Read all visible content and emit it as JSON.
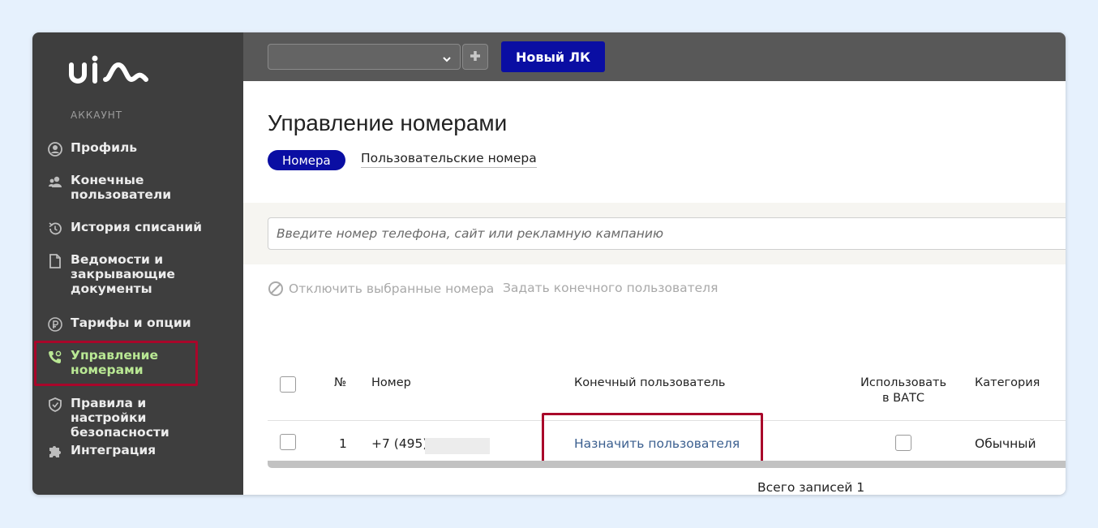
{
  "brand": {
    "logo_text": "uis",
    "accent_color": "#0a0ea3",
    "active_color": "#b9e894",
    "highlight_color": "#a9062a"
  },
  "sidebar": {
    "section_label": "АККАУНТ",
    "items": [
      {
        "label": "Профиль",
        "icon": "profile-icon"
      },
      {
        "label": "Конечные пользователи",
        "icon": "users-icon"
      },
      {
        "label": "История списаний",
        "icon": "history-icon"
      },
      {
        "label": "Ведомости и закрывающие документы",
        "icon": "document-icon"
      },
      {
        "label": "Тарифы и опции",
        "icon": "ruble-icon"
      },
      {
        "label": "Управление номерами",
        "icon": "phone-settings-icon",
        "active": true
      },
      {
        "label": "Правила и настройки безопасности",
        "icon": "shield-icon"
      },
      {
        "label": "Интеграция",
        "icon": "puzzle-icon"
      }
    ]
  },
  "topbar": {
    "account_select_value": "",
    "new_lk_label": "Новый ЛК"
  },
  "main": {
    "title": "Управление номерами",
    "tabs": [
      {
        "label": "Номера",
        "active": true
      },
      {
        "label": "Пользовательские номера",
        "active": false
      }
    ],
    "search": {
      "placeholder": "Введите номер телефона, сайт или рекламную кампанию",
      "value": ""
    },
    "actions": {
      "disable": "Отключить выбранные номера",
      "assign": "Задать конечного пользователя"
    },
    "table": {
      "columns": [
        "№",
        "Номер",
        "Конечный пользователь",
        "Использовать в ВАТС",
        "Категория"
      ],
      "rows": [
        {
          "index": "1",
          "number": "+7 (495) 1",
          "user_action": "Назначить пользователя",
          "use_in_vats": false,
          "category": "Обычный"
        }
      ]
    },
    "total_label": "Всего записей 1"
  }
}
